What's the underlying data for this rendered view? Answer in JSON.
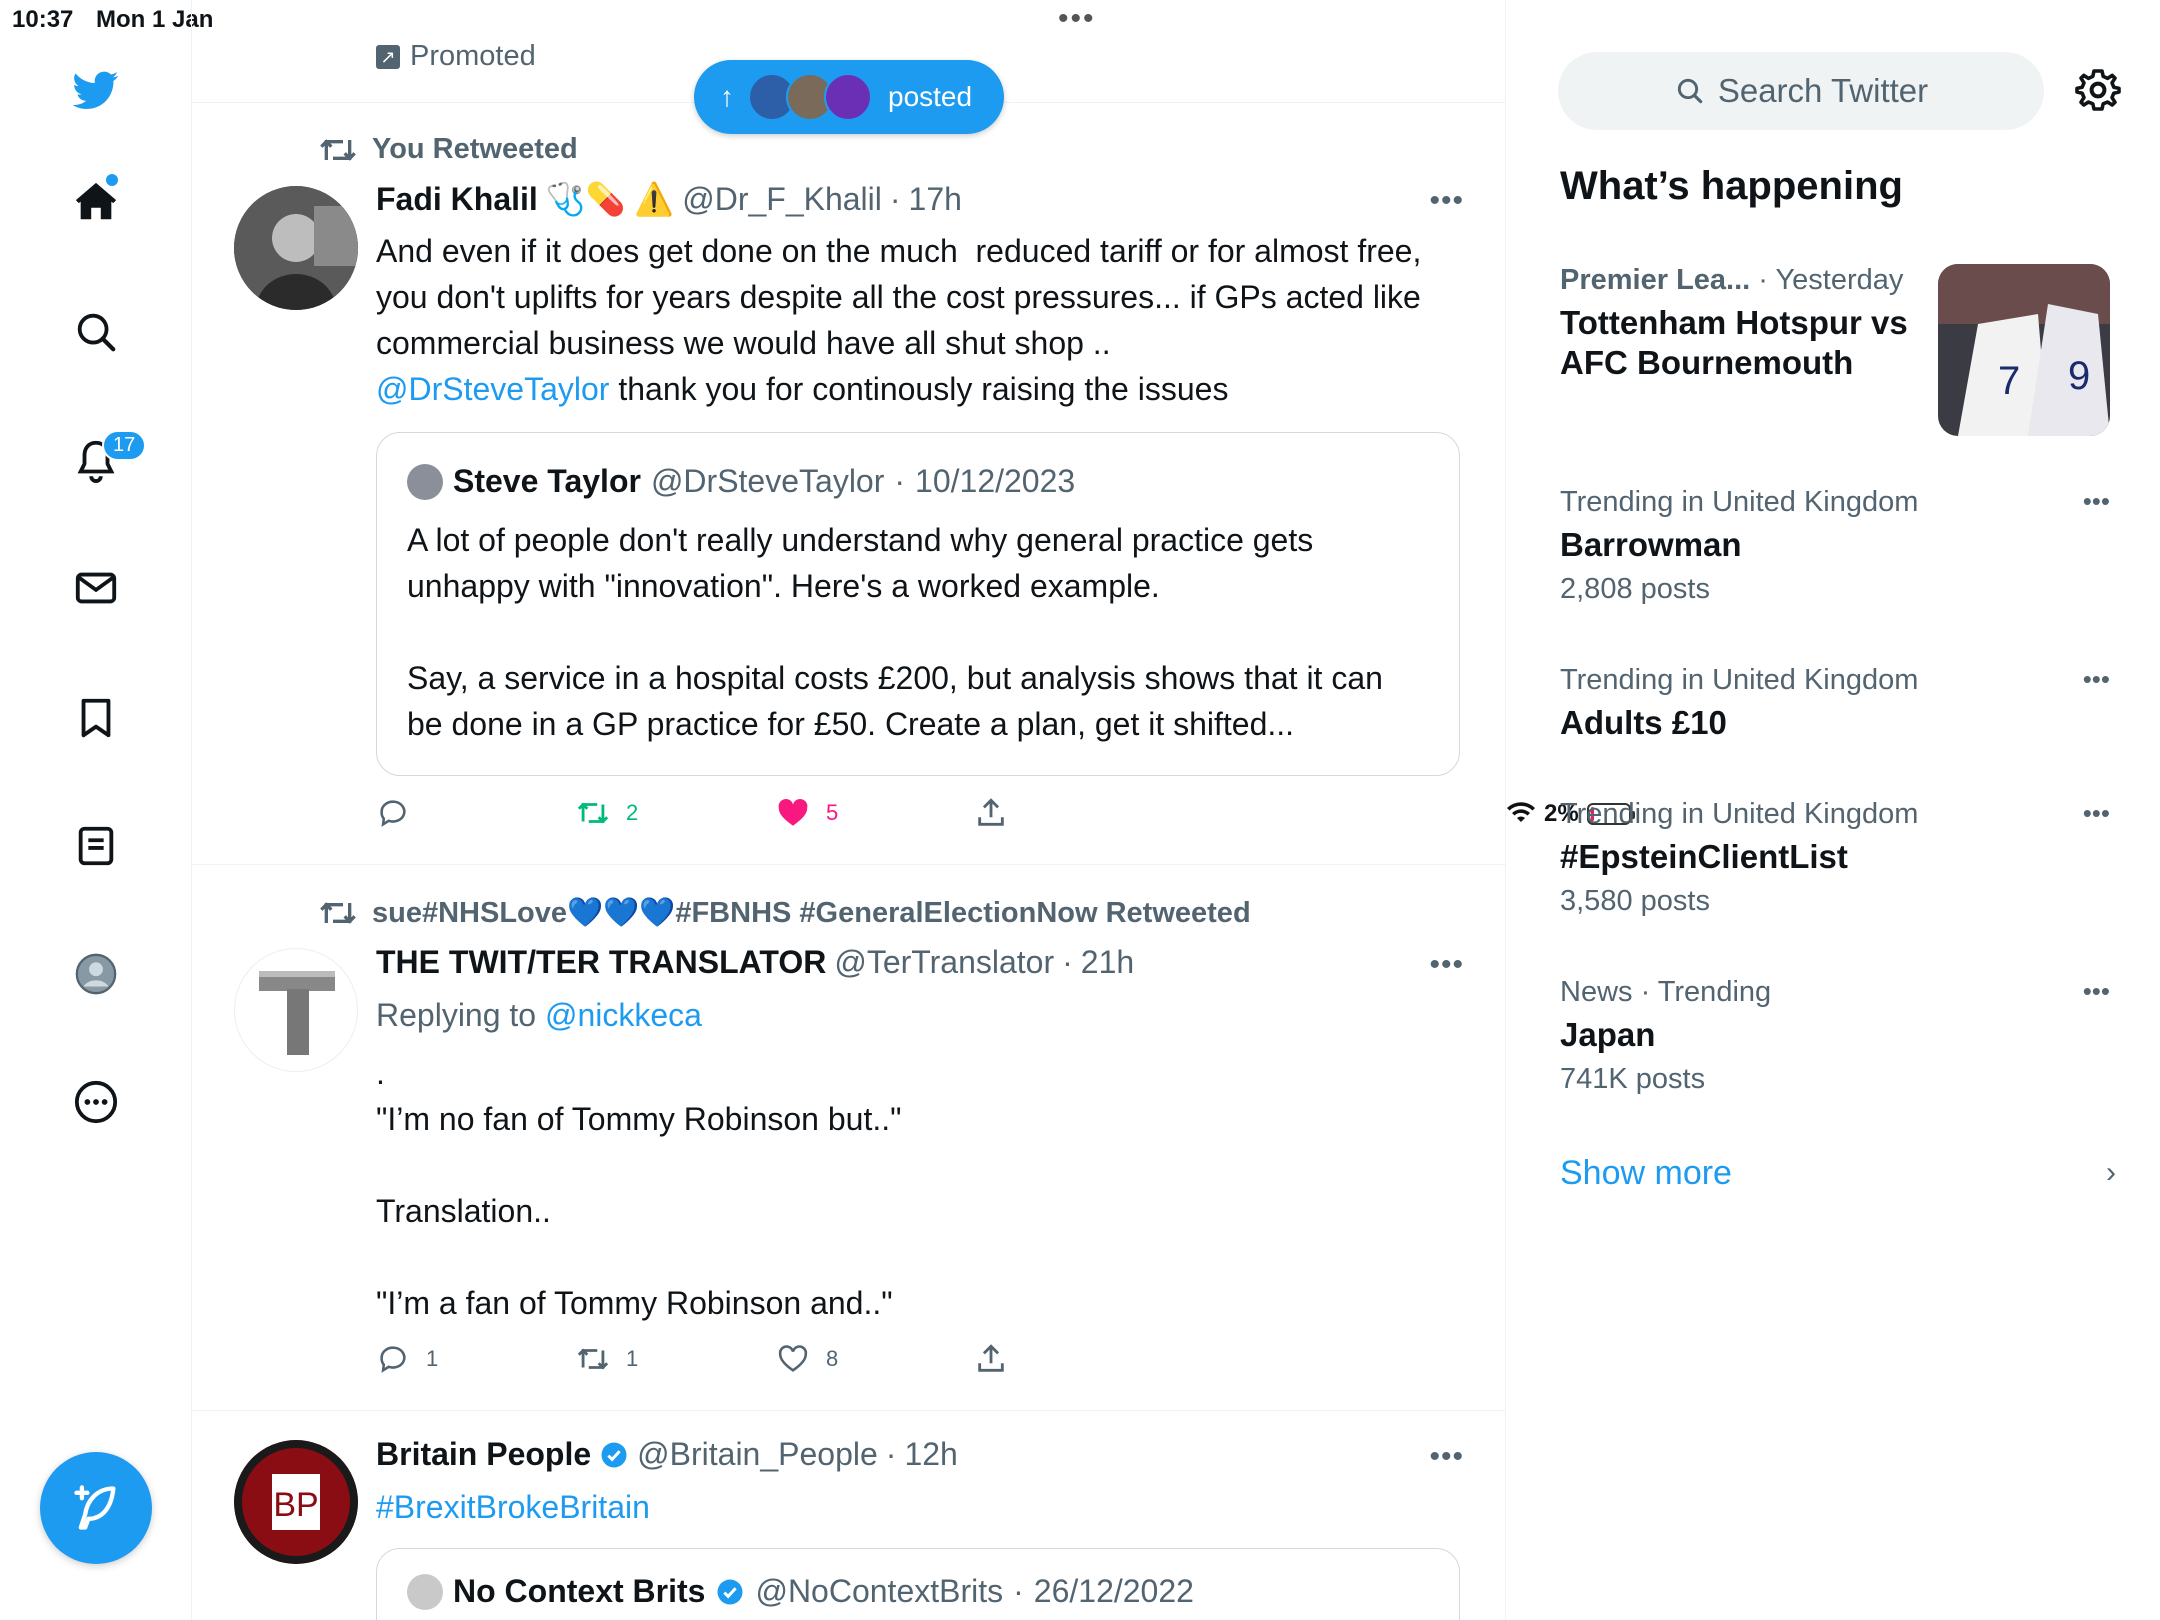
{
  "status": {
    "time": "10:37",
    "date": "Mon 1 Jan",
    "battery": "2%",
    "battery_level": 0.02
  },
  "nav": {
    "items": [
      {
        "name": "twitter-logo"
      },
      {
        "name": "home"
      },
      {
        "name": "explore"
      },
      {
        "name": "notifications",
        "badge": "17"
      },
      {
        "name": "messages"
      },
      {
        "name": "bookmarks"
      },
      {
        "name": "lists"
      },
      {
        "name": "profile"
      },
      {
        "name": "more"
      }
    ],
    "notifications_badge": "17"
  },
  "timeline": {
    "promoted_label": "Promoted",
    "new_posts_pill": {
      "label": "posted"
    },
    "tweets": [
      {
        "retweet_label": "You Retweeted",
        "name": "Fadi Khalil",
        "emojis": "🩺💊 ⚠️",
        "handle": "@Dr_F_Khalil",
        "time": "17h",
        "text_before": "And even if it does get done on the much  reduced tariff or for almost free, you don't uplifts for years despite all the cost pressures... if GPs acted like commercial business we would have all shut shop ..\n",
        "mention": "@DrSteveTaylor",
        "text_after": " thank you for continously raising the issues",
        "quote": {
          "name": "Steve Taylor",
          "handle": "@DrSteveTaylor",
          "time": "10/12/2023",
          "text": "A lot of people don't really understand why general practice gets unhappy with \"innovation\". Here's a worked example.\n\nSay, a service in a hospital costs £200, but analysis shows that it can be done in a GP practice for £50. Create a plan, get it shifted..."
        },
        "replies": "",
        "retweets": "2",
        "likes": "5"
      },
      {
        "retweet_label": "sue#NHSLove💙💙💙#FBNHS #GeneralElectionNow Retweeted",
        "name": "THE TWIT/TER TRANSLATOR",
        "handle": "@TerTranslator",
        "time": "21h",
        "replying_prefix": "Replying to ",
        "replying_to": "@nickkeca",
        "text": ".\n\"I’m no fan of Tommy Robinson but..\"\n\nTranslation..\n\n\"I’m a fan of Tommy Robinson and..\"",
        "replies": "1",
        "retweets": "1",
        "likes": "8"
      },
      {
        "name": "Britain People",
        "handle": "@Britain_People",
        "time": "12h",
        "text": "#BrexitBrokeBritain",
        "avatar_text": "BP",
        "quote": {
          "name": "No Context Brits",
          "handle": "@NoContextBrits",
          "time": "26/12/2022"
        }
      }
    ]
  },
  "sidebar": {
    "search_placeholder": "Search Twitter",
    "whats_happening": "What’s happening",
    "trends": [
      {
        "category": "Premier Lea...",
        "time": "Yesterday",
        "title": "Tottenham Hotspur vs AFC Bournemouth"
      },
      {
        "category": "Trending in United Kingdom",
        "title": "Barrowman",
        "count": "2,808 posts"
      },
      {
        "category": "Trending in United Kingdom",
        "title": "Adults £10"
      },
      {
        "category": "Trending in United Kingdom",
        "title": "#EpsteinClientList",
        "count": "3,580 posts"
      },
      {
        "category": "News · Trending",
        "title": "Japan",
        "count": "741K posts"
      }
    ],
    "show_more": "Show more"
  },
  "colors": {
    "accent": "#1d9bf0",
    "retweet_green": "#00ba7c",
    "like_pink": "#f91880",
    "secondary_text": "#536471"
  }
}
